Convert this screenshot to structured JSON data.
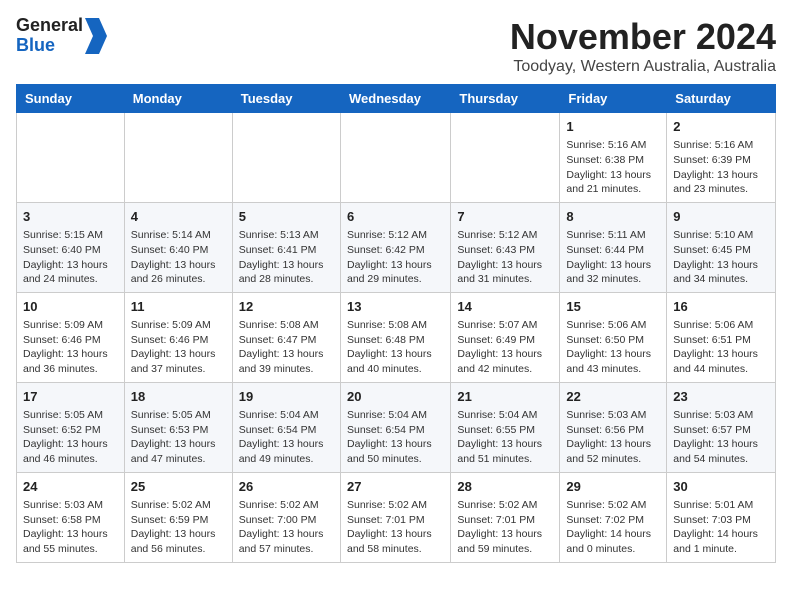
{
  "header": {
    "logo_line1": "General",
    "logo_line2": "Blue",
    "month": "November 2024",
    "location": "Toodyay, Western Australia, Australia"
  },
  "weekdays": [
    "Sunday",
    "Monday",
    "Tuesday",
    "Wednesday",
    "Thursday",
    "Friday",
    "Saturday"
  ],
  "weeks": [
    [
      {
        "day": "",
        "info": ""
      },
      {
        "day": "",
        "info": ""
      },
      {
        "day": "",
        "info": ""
      },
      {
        "day": "",
        "info": ""
      },
      {
        "day": "",
        "info": ""
      },
      {
        "day": "1",
        "info": "Sunrise: 5:16 AM\nSunset: 6:38 PM\nDaylight: 13 hours and 21 minutes."
      },
      {
        "day": "2",
        "info": "Sunrise: 5:16 AM\nSunset: 6:39 PM\nDaylight: 13 hours and 23 minutes."
      }
    ],
    [
      {
        "day": "3",
        "info": "Sunrise: 5:15 AM\nSunset: 6:40 PM\nDaylight: 13 hours and 24 minutes."
      },
      {
        "day": "4",
        "info": "Sunrise: 5:14 AM\nSunset: 6:40 PM\nDaylight: 13 hours and 26 minutes."
      },
      {
        "day": "5",
        "info": "Sunrise: 5:13 AM\nSunset: 6:41 PM\nDaylight: 13 hours and 28 minutes."
      },
      {
        "day": "6",
        "info": "Sunrise: 5:12 AM\nSunset: 6:42 PM\nDaylight: 13 hours and 29 minutes."
      },
      {
        "day": "7",
        "info": "Sunrise: 5:12 AM\nSunset: 6:43 PM\nDaylight: 13 hours and 31 minutes."
      },
      {
        "day": "8",
        "info": "Sunrise: 5:11 AM\nSunset: 6:44 PM\nDaylight: 13 hours and 32 minutes."
      },
      {
        "day": "9",
        "info": "Sunrise: 5:10 AM\nSunset: 6:45 PM\nDaylight: 13 hours and 34 minutes."
      }
    ],
    [
      {
        "day": "10",
        "info": "Sunrise: 5:09 AM\nSunset: 6:46 PM\nDaylight: 13 hours and 36 minutes."
      },
      {
        "day": "11",
        "info": "Sunrise: 5:09 AM\nSunset: 6:46 PM\nDaylight: 13 hours and 37 minutes."
      },
      {
        "day": "12",
        "info": "Sunrise: 5:08 AM\nSunset: 6:47 PM\nDaylight: 13 hours and 39 minutes."
      },
      {
        "day": "13",
        "info": "Sunrise: 5:08 AM\nSunset: 6:48 PM\nDaylight: 13 hours and 40 minutes."
      },
      {
        "day": "14",
        "info": "Sunrise: 5:07 AM\nSunset: 6:49 PM\nDaylight: 13 hours and 42 minutes."
      },
      {
        "day": "15",
        "info": "Sunrise: 5:06 AM\nSunset: 6:50 PM\nDaylight: 13 hours and 43 minutes."
      },
      {
        "day": "16",
        "info": "Sunrise: 5:06 AM\nSunset: 6:51 PM\nDaylight: 13 hours and 44 minutes."
      }
    ],
    [
      {
        "day": "17",
        "info": "Sunrise: 5:05 AM\nSunset: 6:52 PM\nDaylight: 13 hours and 46 minutes."
      },
      {
        "day": "18",
        "info": "Sunrise: 5:05 AM\nSunset: 6:53 PM\nDaylight: 13 hours and 47 minutes."
      },
      {
        "day": "19",
        "info": "Sunrise: 5:04 AM\nSunset: 6:54 PM\nDaylight: 13 hours and 49 minutes."
      },
      {
        "day": "20",
        "info": "Sunrise: 5:04 AM\nSunset: 6:54 PM\nDaylight: 13 hours and 50 minutes."
      },
      {
        "day": "21",
        "info": "Sunrise: 5:04 AM\nSunset: 6:55 PM\nDaylight: 13 hours and 51 minutes."
      },
      {
        "day": "22",
        "info": "Sunrise: 5:03 AM\nSunset: 6:56 PM\nDaylight: 13 hours and 52 minutes."
      },
      {
        "day": "23",
        "info": "Sunrise: 5:03 AM\nSunset: 6:57 PM\nDaylight: 13 hours and 54 minutes."
      }
    ],
    [
      {
        "day": "24",
        "info": "Sunrise: 5:03 AM\nSunset: 6:58 PM\nDaylight: 13 hours and 55 minutes."
      },
      {
        "day": "25",
        "info": "Sunrise: 5:02 AM\nSunset: 6:59 PM\nDaylight: 13 hours and 56 minutes."
      },
      {
        "day": "26",
        "info": "Sunrise: 5:02 AM\nSunset: 7:00 PM\nDaylight: 13 hours and 57 minutes."
      },
      {
        "day": "27",
        "info": "Sunrise: 5:02 AM\nSunset: 7:01 PM\nDaylight: 13 hours and 58 minutes."
      },
      {
        "day": "28",
        "info": "Sunrise: 5:02 AM\nSunset: 7:01 PM\nDaylight: 13 hours and 59 minutes."
      },
      {
        "day": "29",
        "info": "Sunrise: 5:02 AM\nSunset: 7:02 PM\nDaylight: 14 hours and 0 minutes."
      },
      {
        "day": "30",
        "info": "Sunrise: 5:01 AM\nSunset: 7:03 PM\nDaylight: 14 hours and 1 minute."
      }
    ]
  ]
}
